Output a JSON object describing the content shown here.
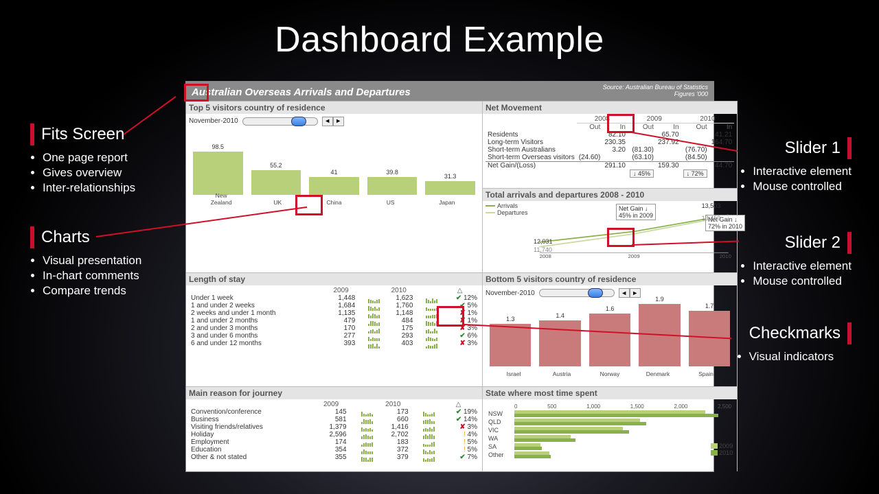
{
  "slide": {
    "title": "Dashboard Example",
    "annotations": {
      "left": [
        {
          "title": "Fits Screen",
          "bullets": [
            "One page report",
            "Gives overview",
            "Inter-relationships"
          ]
        },
        {
          "title": "Charts",
          "bullets": [
            "Visual presentation",
            "In-chart comments",
            "Compare trends"
          ]
        }
      ],
      "right": [
        {
          "title": "Slider 1",
          "bullets": [
            "Interactive element",
            "Mouse controlled"
          ]
        },
        {
          "title": "Slider 2",
          "bullets": [
            "Interactive element",
            "Mouse controlled"
          ]
        },
        {
          "title": "Checkmarks",
          "bullets": [
            "Visual indicators"
          ]
        }
      ]
    }
  },
  "dashboard": {
    "title": "Australian Overseas Arrivals and Departures",
    "source_line1": "Source: Australian Bureau of Statistics",
    "source_line2": "Figures '000",
    "net_movement": {
      "title": "Net Movement",
      "years": [
        "2008",
        "2009",
        "2010"
      ],
      "cols": [
        "Out",
        "In",
        "Out",
        "In",
        "Out",
        "In"
      ],
      "rows": [
        {
          "lbl": "Residents",
          "vals": [
            "",
            "82.10",
            "",
            "65.70",
            "",
            "41.21"
          ]
        },
        {
          "lbl": "Long-term Visitors",
          "vals": [
            "",
            "230.35",
            "",
            "237.92",
            "",
            "164.70"
          ]
        },
        {
          "lbl": "Short-term Australians",
          "vals": [
            "",
            "3.20",
            "(81.30)",
            "",
            "(76.70)",
            ""
          ]
        },
        {
          "lbl": "Short-term Overseas visitors",
          "vals": [
            "(24.60)",
            "",
            "(63.10)",
            "",
            "(84.50)",
            ""
          ]
        }
      ],
      "net_row": {
        "lbl": "Net Gain/(Loss)",
        "vals": [
          "",
          "291.10",
          "",
          "159.30",
          "",
          "44.70"
        ]
      },
      "footers": [
        "",
        "",
        "↓ 45%",
        "",
        "↓ 72%",
        ""
      ]
    },
    "total_arrivals": {
      "title": "Total arrivals and departures 2008 - 2010",
      "legend": [
        "Arrivals",
        "Departures"
      ],
      "tooltip1": "Net Gain ↓\n45% in 2009",
      "tooltip2": "Net Gain ↓\n72% in 2010",
      "label_left_top": "12,031",
      "label_left_bot": "11,740",
      "label_right_top": "13,503",
      "label_right_bot": "13,459",
      "xaxis": [
        "2008",
        "2009",
        "2010"
      ]
    },
    "length_of_stay": {
      "title": "Length of stay",
      "headers": [
        "",
        "2009",
        "",
        "2010",
        "",
        "△"
      ],
      "rows": [
        {
          "lbl": "Under 1 week",
          "a": "1,448",
          "b": "1,623",
          "mark": "chk",
          "d": "12%"
        },
        {
          "lbl": "1 and under 2 weeks",
          "a": "1,684",
          "b": "1,760",
          "mark": "chk",
          "d": "5%"
        },
        {
          "lbl": "2 weeks and under 1 month",
          "a": "1,135",
          "b": "1,148",
          "mark": "xmk",
          "d": "1%"
        },
        {
          "lbl": "1 and under 2 months",
          "a": "479",
          "b": "484",
          "mark": "xmk",
          "d": "1%"
        },
        {
          "lbl": "2 and under 3 months",
          "a": "170",
          "b": "175",
          "mark": "xmk",
          "d": "3%"
        },
        {
          "lbl": "3 and under 6 months",
          "a": "277",
          "b": "293",
          "mark": "chk",
          "d": "6%"
        },
        {
          "lbl": "6 and under 12 months",
          "a": "393",
          "b": "403",
          "mark": "xmk",
          "d": "3%"
        }
      ]
    },
    "main_reason": {
      "title": "Main reason for journey",
      "headers": [
        "",
        "2009",
        "",
        "2010",
        "",
        "△"
      ],
      "rows": [
        {
          "lbl": "Convention/conference",
          "a": "145",
          "b": "173",
          "mark": "chk",
          "d": "19%"
        },
        {
          "lbl": "Business",
          "a": "581",
          "b": "660",
          "mark": "chk",
          "d": "14%"
        },
        {
          "lbl": "Visiting friends/relatives",
          "a": "1,379",
          "b": "1,416",
          "mark": "xmk",
          "d": "3%"
        },
        {
          "lbl": "Holiday",
          "a": "2,596",
          "b": "2,702",
          "mark": "",
          "d": "4%"
        },
        {
          "lbl": "Employment",
          "a": "174",
          "b": "183",
          "mark": "",
          "d": "5%"
        },
        {
          "lbl": "Education",
          "a": "354",
          "b": "372",
          "mark": "",
          "d": "5%"
        },
        {
          "lbl": "Other & not stated",
          "a": "355",
          "b": "379",
          "mark": "chk",
          "d": "7%"
        }
      ]
    },
    "top5": {
      "title": "Top 5 visitors country of residence",
      "month": "November-2010",
      "yticks": [
        "0",
        "50",
        "100",
        "150"
      ]
    },
    "bottom5": {
      "title": "Bottom 5 visitors country of residence",
      "month": "November-2010",
      "yticks": [
        "0.0",
        "0.5",
        "1.0",
        "1.5",
        "2.0"
      ]
    },
    "state": {
      "title": "State where most time spent",
      "xticks": [
        "0",
        "500",
        "1,000",
        "1,500",
        "2,000",
        "2,500"
      ],
      "legend": [
        "2009",
        "2010"
      ]
    }
  },
  "chart_data": [
    {
      "type": "line",
      "title": "Total arrivals and departures 2008 - 2010",
      "x": [
        2008,
        2009,
        2010
      ],
      "series": [
        {
          "name": "Arrivals",
          "values": [
            12031,
            12800,
            13503
          ]
        },
        {
          "name": "Departures",
          "values": [
            11740,
            12640,
            13459
          ]
        }
      ],
      "annotations": [
        "Net Gain ↓ 45% in 2009",
        "Net Gain ↓ 72% in 2010"
      ]
    },
    {
      "type": "bar",
      "title": "Top 5 visitors country of residence",
      "categories": [
        "New Zealand",
        "UK",
        "China",
        "US",
        "Japan"
      ],
      "values": [
        98.5,
        55.2,
        41,
        39.8,
        31.3
      ],
      "ylim": [
        0,
        150
      ]
    },
    {
      "type": "bar",
      "title": "Bottom 5 visitors country of residence",
      "categories": [
        "Israel",
        "Austria",
        "Norway",
        "Denmark",
        "Spain"
      ],
      "values": [
        1.3,
        1.4,
        1.6,
        1.9,
        1.7
      ],
      "ylim": [
        0,
        2.0
      ]
    },
    {
      "type": "bar",
      "title": "State where most time spent",
      "orientation": "horizontal",
      "categories": [
        "NSW",
        "QLD",
        "VIC",
        "WA",
        "SA",
        "Other"
      ],
      "series": [
        {
          "name": "2009",
          "values": [
            2200,
            1450,
            1250,
            650,
            300,
            400
          ]
        },
        {
          "name": "2010",
          "values": [
            2350,
            1520,
            1320,
            700,
            320,
            420
          ]
        }
      ],
      "xlim": [
        0,
        2500
      ]
    }
  ]
}
